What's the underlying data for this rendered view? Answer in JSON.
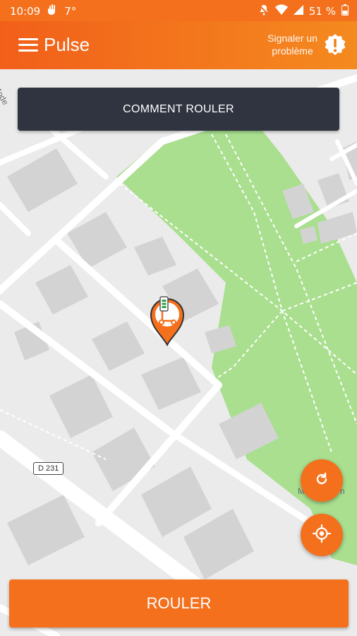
{
  "status_bar": {
    "time": "10:09",
    "temperature": "7°",
    "battery": "51 %"
  },
  "app_bar": {
    "title": "Pulse",
    "report_label_line1": "Signaler un",
    "report_label_line2": "problème"
  },
  "banner": {
    "label": "COMMENT ROULER"
  },
  "map": {
    "road_badge": "D 231",
    "text_top_left": "Mode",
    "text_right": "M",
    "text_right2": "n"
  },
  "actions": {
    "primary_label": "ROULER"
  },
  "icons": {
    "menu": "hamburger-icon",
    "report": "alert-badge-icon",
    "refresh": "refresh-icon",
    "locate": "locate-icon",
    "marker": "scooter-marker-icon"
  },
  "colors": {
    "accent": "#f4701c",
    "banner_bg": "#303440",
    "park": "#a9df8f"
  }
}
